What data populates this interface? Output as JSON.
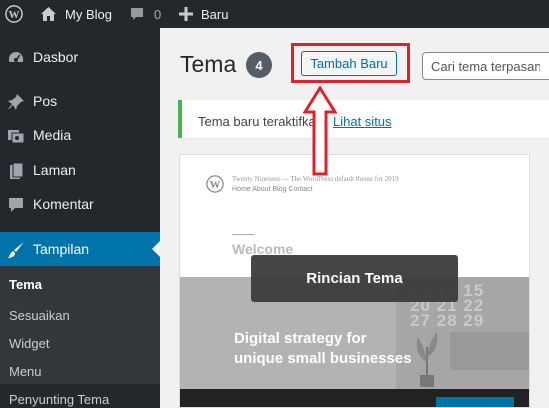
{
  "adminbar": {
    "site_name": "My Blog",
    "comments_count": "0",
    "new_label": "Baru"
  },
  "sidebar": {
    "items": [
      {
        "label": "Dasbor",
        "icon": "dashboard-icon"
      },
      {
        "label": "Pos",
        "icon": "pushpin-icon"
      },
      {
        "label": "Media",
        "icon": "media-icon"
      },
      {
        "label": "Laman",
        "icon": "page-icon"
      },
      {
        "label": "Komentar",
        "icon": "comment-icon"
      },
      {
        "label": "Tampilan",
        "icon": "appearance-brush-icon"
      }
    ],
    "submenu": [
      "Tema",
      "Sesuaikan",
      "Widget",
      "Menu",
      "Penyunting Tema"
    ]
  },
  "main": {
    "title": "Tema",
    "count": "4",
    "add_new_label": "Tambah Baru",
    "search_placeholder": "Cari tema terpasang..."
  },
  "notice": {
    "text": "Tema baru teraktifkan.",
    "link": "Lihat situs"
  },
  "theme": {
    "screenshot_site": "Twenty Nineteen — The WordPress default theme for 2019",
    "screenshot_nav": "Home  About  Blog  Contact",
    "screenshot_welcome": "Welcome",
    "hero_text": "Digital strategy for unique small businesses",
    "calendar_text": "13 14 15\n20 21 22\n27 28 29",
    "details_label": "Rincian Tema"
  },
  "colors": {
    "adminbar_bg": "#23282d",
    "active_menu": "#0073aa",
    "highlight": "#e0202a",
    "notice_border": "#46b450"
  }
}
